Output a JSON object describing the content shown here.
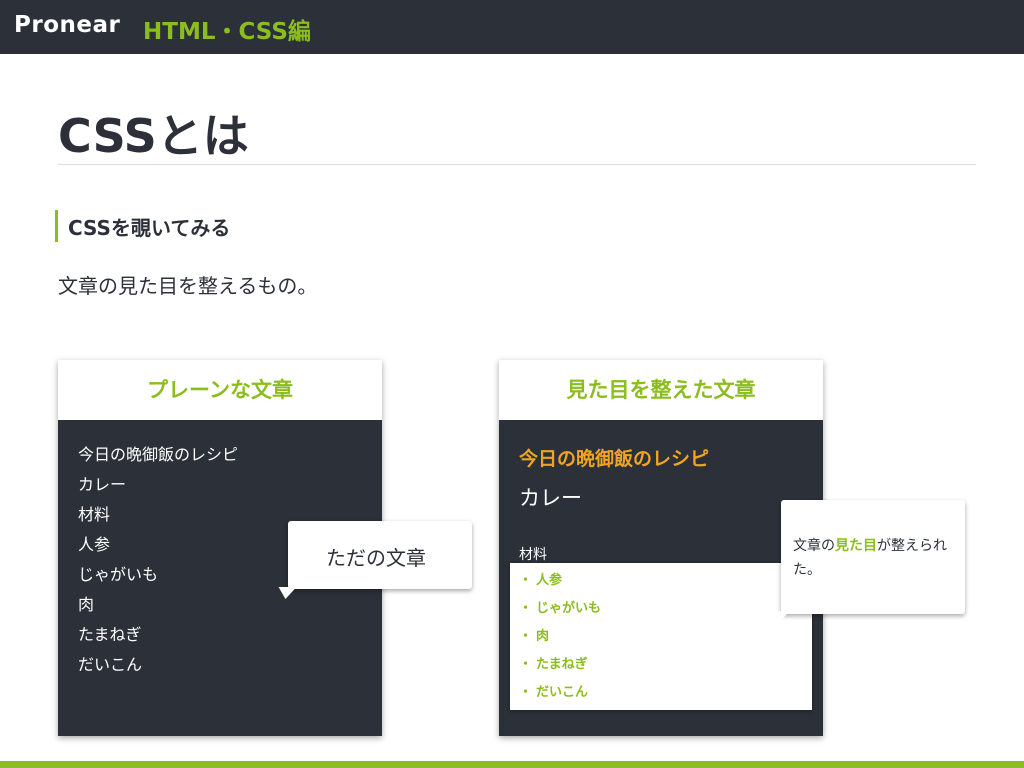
{
  "header": {
    "brand": "Pronear",
    "course": "HTML・CSS編"
  },
  "page": {
    "title": "CSSとは",
    "section_heading": "CSSを覗いてみる",
    "lead": "文章の見た目を整えるもの。"
  },
  "plain_card": {
    "heading": "プレーンな文章",
    "lines": [
      "今日の晩御飯のレシピ",
      "カレー",
      "材料",
      "人参",
      "じゃがいも",
      "肉",
      "たまねぎ",
      "だいこん"
    ]
  },
  "styled_card": {
    "heading": "見た目を整えた文章",
    "recipe_title": "今日の晩御飯のレシピ",
    "dish": "カレー",
    "ingredients_label": "材料",
    "bullet": "・",
    "ingredients": [
      "人参",
      "じゃがいも",
      "肉",
      "たまねぎ",
      "だいこん"
    ]
  },
  "callouts": {
    "plain": "ただの文章",
    "styled_before": "文章の",
    "styled_highlight": "見た目",
    "styled_after": "が整えられた。"
  },
  "colors": {
    "dark": "#2b3039",
    "accent_green": "#8cbd1f",
    "accent_orange": "#f0a422"
  }
}
